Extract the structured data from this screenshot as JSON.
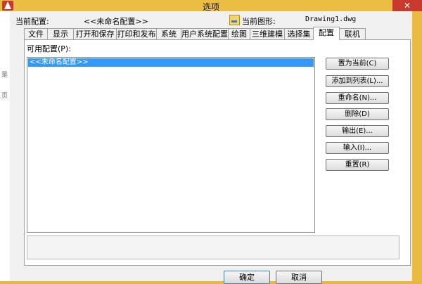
{
  "window": {
    "title": "选项",
    "close": "✕"
  },
  "background_glyphs": [
    "是",
    "页"
  ],
  "header": {
    "current_profile_label": "当前配置:",
    "current_profile_value": "<<未命名配置>>",
    "current_drawing_label": "当前图形:",
    "current_drawing_value": "Drawing1.dwg"
  },
  "tabs": [
    "文件",
    "显示",
    "打开和保存",
    "打印和发布",
    "系统",
    "用户系统配置",
    "绘图",
    "三维建模",
    "选择集",
    "配置",
    "联机"
  ],
  "active_tab": "配置",
  "profiles": {
    "label": "可用配置(P):",
    "items": [
      "<<未命名配置>>"
    ]
  },
  "actions": [
    "置为当前(C)",
    "添加到列表(L)...",
    "重命名(N)...",
    "删除(D)",
    "输出(E)...",
    "输入(I)...",
    "重置(R)"
  ],
  "buttons": {
    "ok": "确定",
    "cancel": "取消"
  },
  "colors": {
    "frame": "#ecbd43",
    "selection": "#3399ff",
    "close": "#c8392e"
  }
}
